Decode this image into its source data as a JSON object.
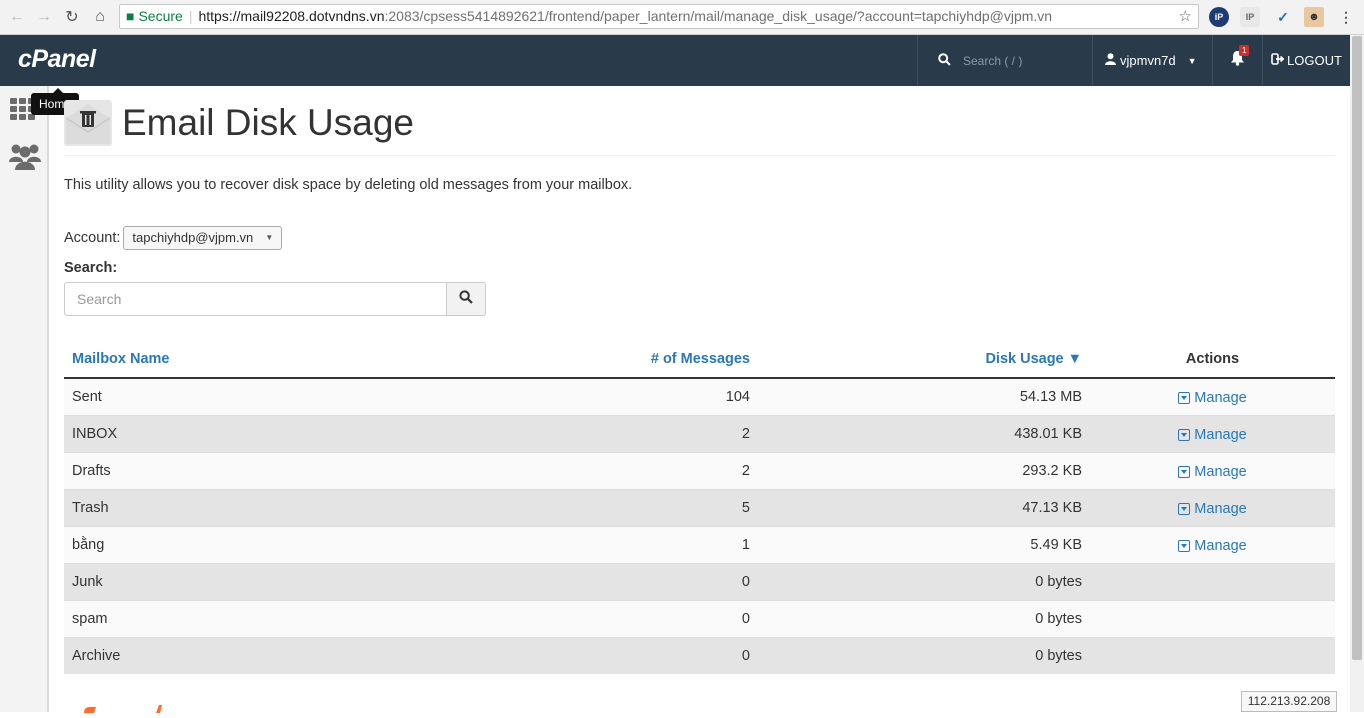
{
  "browser": {
    "secure_label": "Secure",
    "url_host": "https://mail92208.dotvndns.vn",
    "url_rest": ":2083/cpsess5414892621/frontend/paper_lantern/mail/manage_disk_usage/?account=tapchiyhdp@vjpm.vn",
    "icons": [
      "back-icon",
      "forward-icon",
      "reload-icon",
      "home-icon",
      "lock-icon",
      "star-icon"
    ]
  },
  "header": {
    "logo": "cPanel",
    "search_placeholder": "Search ( / )",
    "username": "vjpmvn7d",
    "notification_count": "1",
    "logout_label": "LOGOUT"
  },
  "sidebar": {
    "tooltip": "Home"
  },
  "page": {
    "title": "Email Disk Usage",
    "description": "This utility allows you to recover disk space by deleting old messages from your mailbox.",
    "account_label": "Account:",
    "account_value": "tapchiyhdp@vjpm.vn",
    "search_label": "Search:",
    "search_placeholder": "Search"
  },
  "table": {
    "headers": {
      "name": "Mailbox Name",
      "messages": "# of Messages",
      "usage": "Disk Usage ▼",
      "actions": "Actions"
    },
    "manage_label": "Manage",
    "rows": [
      {
        "name": "Sent",
        "messages": "104",
        "usage": "54.13 MB",
        "manage": true
      },
      {
        "name": "INBOX",
        "messages": "2",
        "usage": "438.01 KB",
        "manage": true
      },
      {
        "name": "Drafts",
        "messages": "2",
        "usage": "293.2 KB",
        "manage": true
      },
      {
        "name": "Trash",
        "messages": "5",
        "usage": "47.13 KB",
        "manage": true
      },
      {
        "name": "bằng",
        "messages": "1",
        "usage": "5.49 KB",
        "manage": true
      },
      {
        "name": "Junk",
        "messages": "0",
        "usage": "0 bytes",
        "manage": false
      },
      {
        "name": "spam",
        "messages": "0",
        "usage": "0 bytes",
        "manage": false
      },
      {
        "name": "Archive",
        "messages": "0",
        "usage": "0 bytes",
        "manage": false
      }
    ]
  },
  "footer": {
    "ip": "112.213.92.208"
  }
}
